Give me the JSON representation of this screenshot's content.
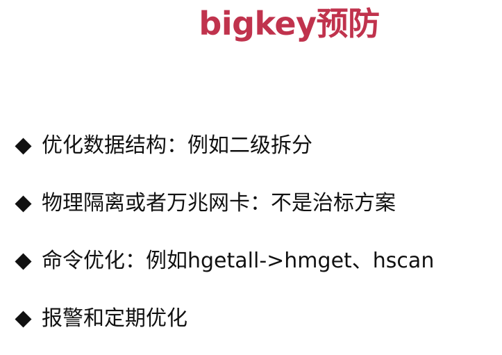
{
  "slide": {
    "title": "bigkey预防",
    "title_color": "#c0334d",
    "bullet_icon": "black-diamond",
    "bullets": [
      {
        "text": "优化数据结构：例如二级拆分"
      },
      {
        "text": "物理隔离或者万兆网卡：不是治标方案"
      },
      {
        "text": "命令优化：例如hgetall->hmget、hscan"
      },
      {
        "text": "报警和定期优化"
      }
    ]
  }
}
